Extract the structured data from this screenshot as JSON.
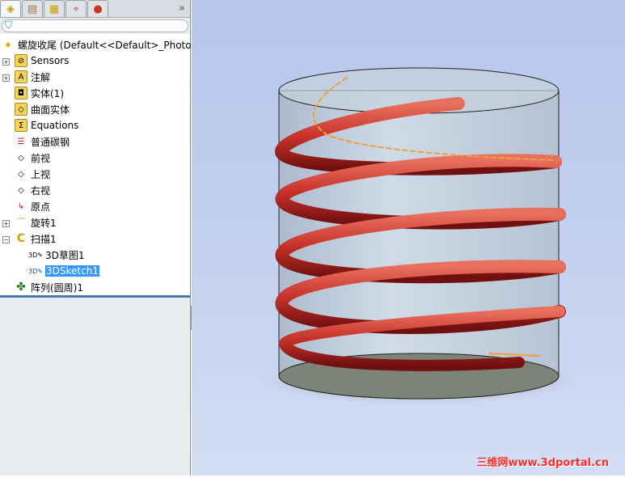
{
  "tabs": [
    {
      "name": "feature-manager-tab",
      "icon": "feature-tree-icon"
    },
    {
      "name": "property-manager-tab",
      "icon": "property-icon"
    },
    {
      "name": "configuration-manager-tab",
      "icon": "config-icon"
    },
    {
      "name": "dimxpert-tab",
      "icon": "crosshair-icon"
    },
    {
      "name": "display-manager-tab",
      "icon": "color-wheel-icon"
    }
  ],
  "more_label": "»",
  "tree": {
    "root": "螺旋收尾  (Default<<Default>_PhotoW",
    "items": [
      "Sensors",
      "注解",
      "实体(1)",
      "曲面实体",
      "Equations",
      "普通碳钢",
      "前视",
      "上视",
      "右视",
      "原点",
      "旋转1",
      "扫描1",
      "3D草图1",
      "3DSketch1",
      "阵列(圆周)1"
    ]
  },
  "watermark": "三维网www.3dportal.cn",
  "colors": {
    "selection": "#3399ff",
    "coil": "#c8322a",
    "cylinder": "#c9d6e2"
  }
}
